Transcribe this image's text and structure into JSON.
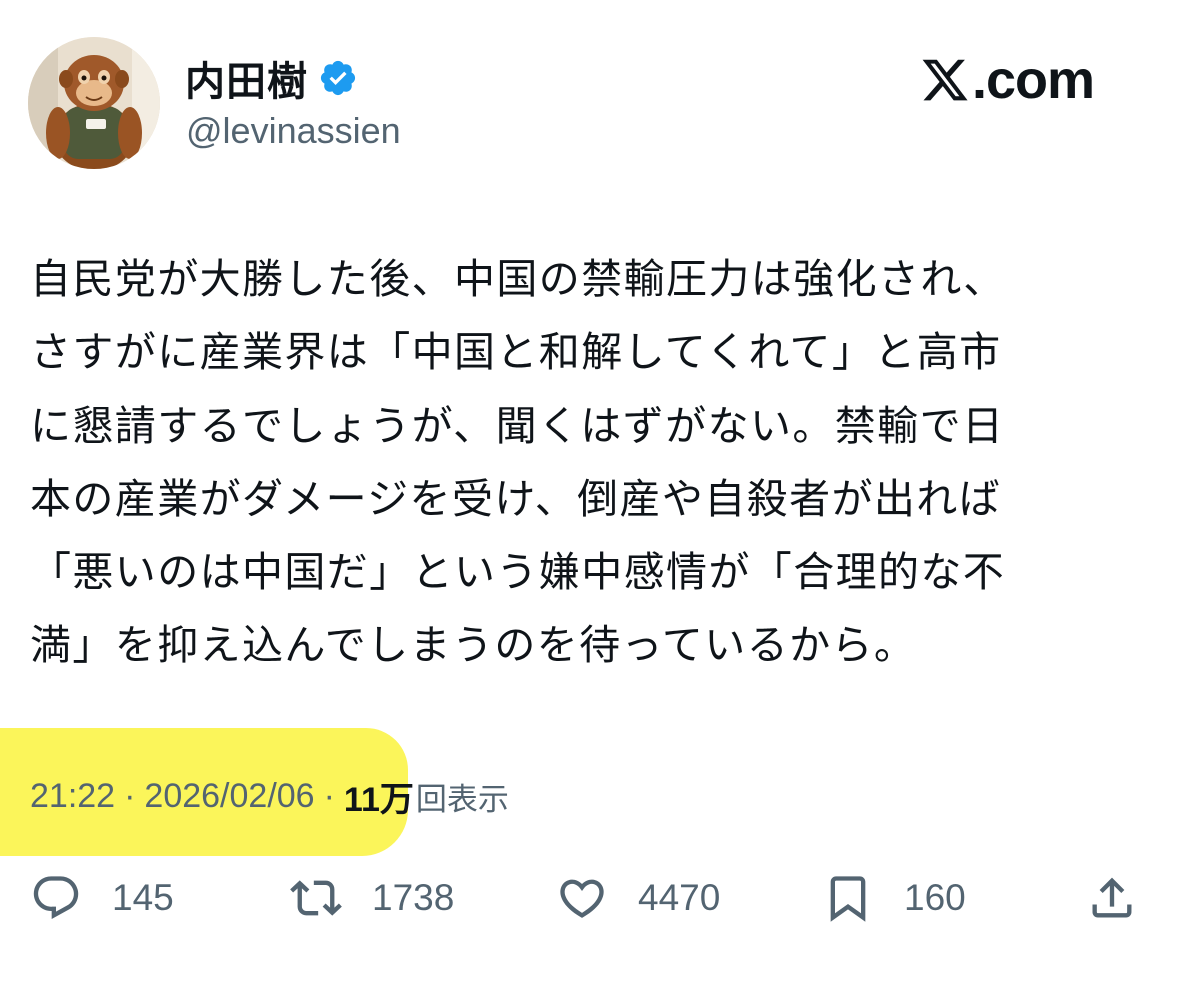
{
  "author": {
    "display_name": "内田樹",
    "handle": "@levinassien",
    "verified": true,
    "avatar_icon": "orangutan-plush-avatar"
  },
  "brand": {
    "icon": "x-logo-icon",
    "text": ".com"
  },
  "tweet": {
    "lines": [
      "自民党が大勝した後、中国の禁輸圧力は強化され、",
      "さすがに産業界は「中国と和解してくれて」と高市",
      "に懇請するでしょうが、聞くはずがない。禁輸で日",
      "本の産業がダメージを受け、倒産や自殺者が出れば",
      "「悪いのは中国だ」という嫌中感情が「合理的な不",
      "満」を抑え込んでしまうのを待っているから。"
    ]
  },
  "meta": {
    "time": "21:22",
    "separator": "·",
    "date": "2026/02/06",
    "views_count": "11万",
    "views_label": "回表示"
  },
  "actions": {
    "replies": "145",
    "reposts": "1738",
    "likes": "4470",
    "bookmarks": "160"
  },
  "colors": {
    "text": "#0f1419",
    "secondary": "#536471",
    "verified": "#1d9bf0",
    "highlight": "#fbf55a"
  }
}
